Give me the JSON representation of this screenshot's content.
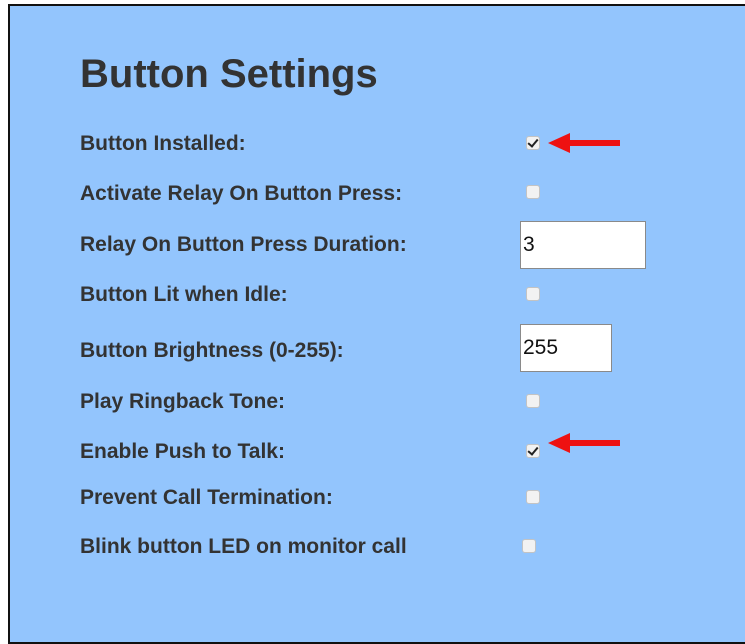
{
  "section": {
    "title": "Button Settings"
  },
  "settings": [
    {
      "label": "Button Installed:",
      "type": "checkbox",
      "checked": true
    },
    {
      "label": "Activate Relay On Button Press:",
      "type": "checkbox",
      "checked": false
    },
    {
      "label": "Relay On Button Press Duration:",
      "type": "text",
      "value": "3"
    },
    {
      "label": "Button Lit when Idle:",
      "type": "checkbox",
      "checked": false
    },
    {
      "label": "Button Brightness (0-255):",
      "type": "text",
      "value": "255"
    },
    {
      "label": "Play Ringback Tone:",
      "type": "checkbox",
      "checked": false
    },
    {
      "label": "Enable Push to Talk:",
      "type": "checkbox",
      "checked": true
    },
    {
      "label": "Prevent Call Termination:",
      "type": "checkbox",
      "checked": false
    },
    {
      "label": "Blink button LED on monitor call",
      "type": "checkbox",
      "checked": false
    }
  ],
  "annotations": {
    "arrow_color": "#ee1111",
    "arrow_icon": "red-arrow-left-icon"
  },
  "colors": {
    "panel_background": "#93c5fd",
    "panel_border": "#111111",
    "text": "#333333"
  }
}
